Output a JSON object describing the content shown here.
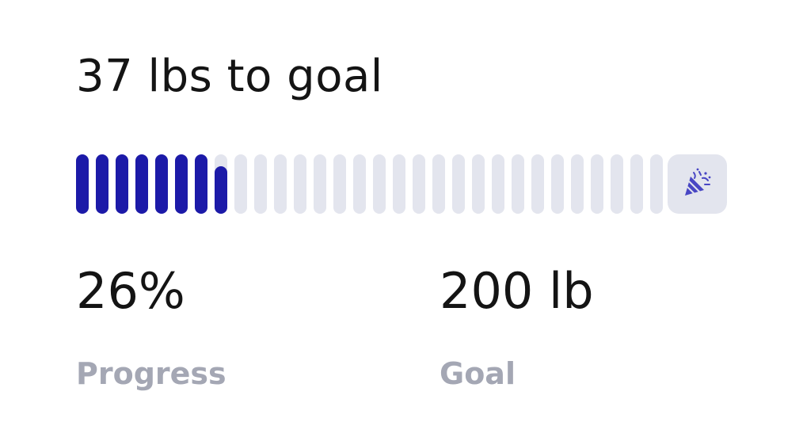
{
  "header": {
    "title": "37 lbs to goal"
  },
  "progress_bar": {
    "fraction": 0.26,
    "segment_count": 30,
    "filled_color": "#1c1aa8",
    "empty_color": "#e3e5ee",
    "goal_icon": "party-popper-icon",
    "goal_icon_color": "#4846c4"
  },
  "stats": {
    "progress": {
      "value": "26%",
      "label": "Progress"
    },
    "goal": {
      "value": "200 lb",
      "label": "Goal"
    }
  }
}
